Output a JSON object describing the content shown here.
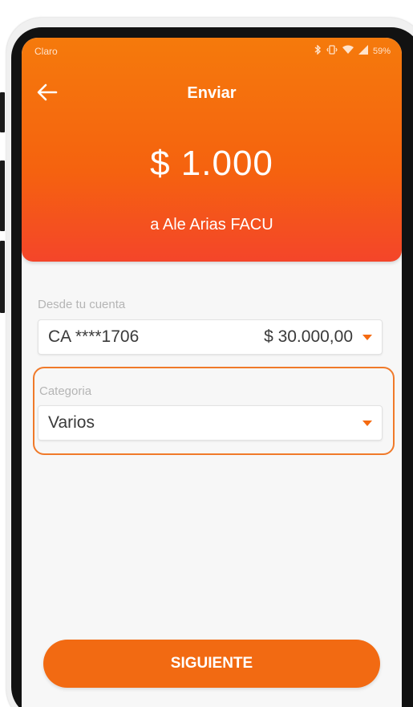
{
  "status_bar": {
    "carrier": "Claro",
    "battery": "59%",
    "icons": [
      "bluetooth-icon",
      "vibrate-icon",
      "wifi-icon",
      "signal-icon"
    ]
  },
  "header": {
    "back_icon": "arrow-left-icon",
    "title": "Enviar",
    "amount": "$ 1.000",
    "recipient": "a Ale Arias FACU"
  },
  "account": {
    "label": "Desde tu cuenta",
    "value": "CA ****1706",
    "balance": "$ 30.000,00"
  },
  "category": {
    "label": "Categoria",
    "value": "Varios"
  },
  "actions": {
    "next_label": "SIGUIENTE"
  },
  "colors": {
    "accent": "#f26a12",
    "header_top": "#f57a0c",
    "header_bottom": "#f4452a",
    "highlight": "#f07a2a"
  }
}
